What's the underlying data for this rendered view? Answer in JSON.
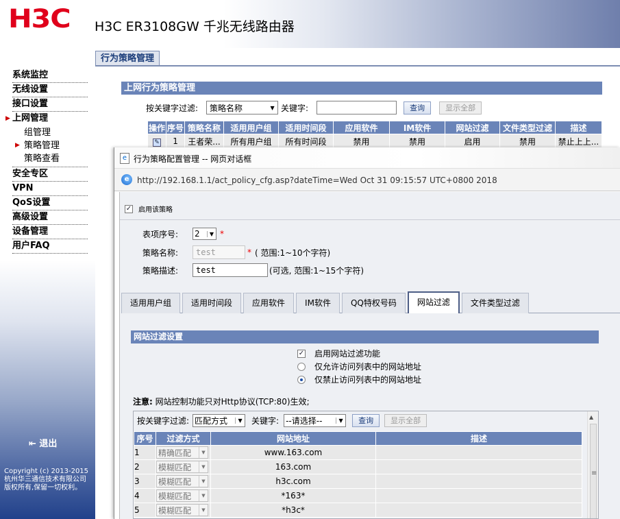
{
  "brand": {
    "logo": "H3C",
    "product": "H3C ER3108GW 千兆无线路由器"
  },
  "sidebar": {
    "items": [
      {
        "label": "系统监控"
      },
      {
        "label": "无线设置"
      },
      {
        "label": "接口设置"
      },
      {
        "label": "上网管理",
        "active": true
      },
      {
        "label": "安全专区"
      },
      {
        "label": "VPN"
      },
      {
        "label": "QoS设置"
      },
      {
        "label": "高级设置"
      },
      {
        "label": "设备管理"
      },
      {
        "label": "用户FAQ"
      }
    ],
    "subitems": [
      {
        "label": "组管理"
      },
      {
        "label": "策略管理",
        "active": true
      },
      {
        "label": "策略查看"
      }
    ],
    "logout": "退出",
    "copyright": "Copyright (c) 2013-2015 杭州华三通信技术有限公司 版权所有,保留一切权利。"
  },
  "main": {
    "tab": "行为策略管理",
    "section_title": "上网行为策略管理",
    "filter": {
      "label": "按关键字过滤:",
      "field": "策略名称",
      "keyword_label": "关键字:",
      "keyword_value": "",
      "query": "查询",
      "show_all": "显示全部"
    },
    "table": {
      "headers": [
        "操作",
        "序号",
        "策略名称",
        "适用用户组",
        "适用时间段",
        "应用软件",
        "IM软件",
        "网站过滤",
        "文件类型过滤",
        "描述"
      ],
      "rows": [
        [
          "",
          "1",
          "王者荣...",
          "所有用户组",
          "所有时间段",
          "禁用",
          "禁用",
          "启用",
          "禁用",
          "禁止上上..."
        ]
      ]
    }
  },
  "dialog": {
    "title": "行为策略配置管理 -- 网页对话框",
    "url": "http://192.168.1.1/act_policy_cfg.asp?dateTime=Wed Oct 31 09:15:57 UTC+0800 2018",
    "enable_policy": "启用该策略",
    "form": {
      "index_label": "表项序号:",
      "index_value": "2",
      "required_mark": "*",
      "name_label": "策略名称:",
      "name_value": "test",
      "name_hint": "( 范围:1~10个字符)",
      "desc_label": "策略描述:",
      "desc_value": "test",
      "desc_hint": "(可选, 范围:1~15个字符)"
    },
    "tabs": [
      "适用用户组",
      "适用时间段",
      "应用软件",
      "IM软件",
      "QQ特权号码",
      "网站过滤",
      "文件类型过滤"
    ],
    "active_tab": "网站过滤",
    "url_filter": {
      "section_title": "网站过滤设置",
      "enable_label": "启用网站过滤功能",
      "allow_label": "仅允许访问列表中的网站地址",
      "deny_label": "仅禁止访问列表中的网站地址",
      "note_prefix": "注意:",
      "note_text": "网站控制功能只对Http协议(TCP:80)生效;",
      "filter_label": "按关键字过滤:",
      "match_field": "匹配方式",
      "keyword_label": "关键字:",
      "keyword_value": "--请选择--",
      "query": "查询",
      "show_all": "显示全部",
      "headers": [
        "序号",
        "过滤方式",
        "网站地址",
        "描述"
      ],
      "rows": [
        {
          "no": "1",
          "mode": "精确匹配",
          "url": "www.163.com",
          "desc": ""
        },
        {
          "no": "2",
          "mode": "模糊匹配",
          "url": "163.com",
          "desc": ""
        },
        {
          "no": "3",
          "mode": "模糊匹配",
          "url": "h3c.com",
          "desc": ""
        },
        {
          "no": "4",
          "mode": "模糊匹配",
          "url": "*163*",
          "desc": ""
        },
        {
          "no": "5",
          "mode": "模糊匹配",
          "url": "*h3c*",
          "desc": ""
        }
      ]
    }
  }
}
